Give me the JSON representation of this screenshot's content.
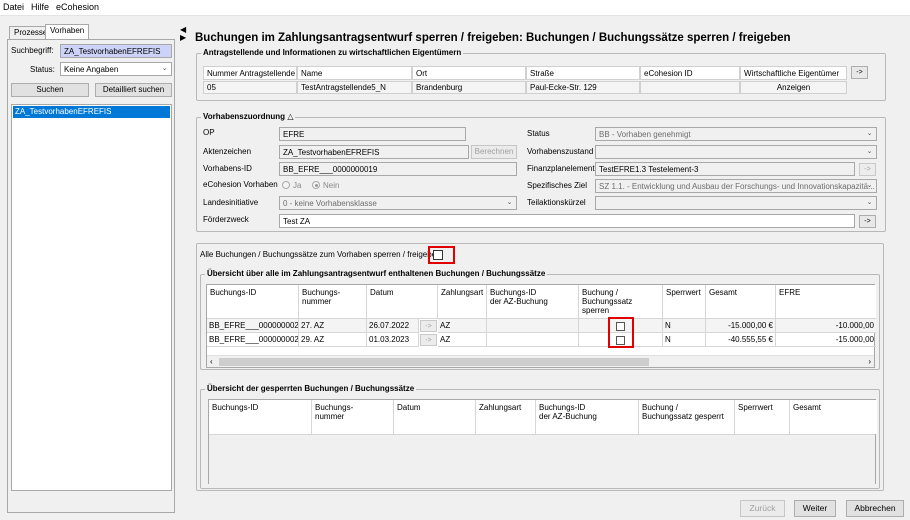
{
  "menu": {
    "items": [
      "Datei",
      "Hilfe",
      "eCohesion"
    ]
  },
  "left": {
    "tabs": [
      "Prozesse",
      "Vorhaben"
    ],
    "search_label": "Suchbegriff:",
    "search_value": "ZA_TestvorhabenEFREFIS",
    "status_label": "Status:",
    "status_value": "Keine Angaben",
    "search_button": "Suchen",
    "detail_search_button": "Detailliert suchen",
    "results": [
      "ZA_TestvorhabenEFREFIS"
    ]
  },
  "main": {
    "title": "Buchungen im Zahlungsantragsentwurf sperren / freigeben: Buchungen / Buchungssätze sperren / freigeben",
    "applicants": {
      "title": "Antragstellende und Informationen zu wirtschaftlichen Eigentümern",
      "headers": [
        "Nummer Antragstellende",
        "Name",
        "Ort",
        "Straße",
        "eCohesion ID",
        "Wirtschaftliche Eigentümer"
      ],
      "row": [
        "05",
        "TestAntragstellende5_N",
        "Brandenburg",
        "Paul-Ecke-Str. 129",
        "",
        "Anzeigen"
      ],
      "more": "->"
    },
    "project": {
      "title": "Vorhabenszuordnung",
      "toggle": "△",
      "op_label": "OP",
      "op_value": "EFRE",
      "aktenzeichen_label": "Aktenzeichen",
      "aktenzeichen_value": "ZA_TestvorhabenEFREFIS",
      "berechnen": "Berechnen",
      "vorhabens_id_label": "Vorhabens-ID",
      "vorhabens_id_value": "BB_EFRE___0000000019",
      "ecohesion_label": "eCohesion Vorhaben",
      "ja": "Ja",
      "nein": "Nein",
      "landesinitiative_label": "Landesinitiative",
      "landesinitiative_value": "0 - keine Vorhabensklasse",
      "foerderzweck_label": "Förderzweck",
      "foerderzweck_value": "Test ZA",
      "status_label": "Status",
      "status_value": "BB - Vorhaben genehmigt",
      "vorhabenszustand_label": "Vorhabenszustand",
      "vorhabenszustand_value": "",
      "finanzplan_label": "Finanzplanelement",
      "finanzplan_value": "TestEFRE1.3 Testelement-3",
      "ziel_label": "Spezifisches Ziel",
      "ziel_value": "SZ 1.1. - Entwicklung und Ausbau der Forschungs- und Innovationskapazitä...",
      "teilaktion_label": "Teilaktionskürzel",
      "teilaktion_value": "",
      "arrow": "->"
    },
    "lock_all_label": "Alle Buchungen / Buchungssätze zum Vorhaben sperren / freigeben",
    "bookings": {
      "title": "Übersicht über alle im Zahlungsantragsentwurf enthaltenen Buchungen / Buchungssätze",
      "headers": [
        "Buchungs-ID",
        "Buchungs-\nnummer",
        "Datum",
        "Zahlungsart",
        "Buchungs-ID\nder AZ-Buchung",
        "Buchung /\nBuchungssatz sperren",
        "Sperrwert",
        "Gesamt",
        "EFRE"
      ],
      "rows": [
        [
          "BB_EFRE___0000000024",
          "27. AZ",
          "26.07.2022",
          "AZ",
          "",
          "",
          "N",
          "-15.000,00 €",
          "-10.000,00"
        ],
        [
          "BB_EFRE___0000000026",
          "29. AZ",
          "01.03.2023",
          "AZ",
          "",
          "",
          "N",
          "-40.555,55 €",
          "-15.000,00"
        ]
      ],
      "row_arrow": "->"
    },
    "locked": {
      "title": "Übersicht der gesperrten Buchungen / Buchungssätze",
      "headers": [
        "Buchungs-ID",
        "Buchungs-\nnummer",
        "Datum",
        "Zahlungsart",
        "Buchungs-ID\nder AZ-Buchung",
        "Buchung /\nBuchungssatz gesperrt",
        "Sperrwert",
        "Gesamt"
      ]
    }
  },
  "footer": {
    "back": "Zurück",
    "next": "Weiter",
    "cancel": "Abbrechen"
  },
  "colors": {
    "selection": "#0078d7",
    "highlight_field": "#cdd3f8",
    "red_marker": "#e00000"
  }
}
